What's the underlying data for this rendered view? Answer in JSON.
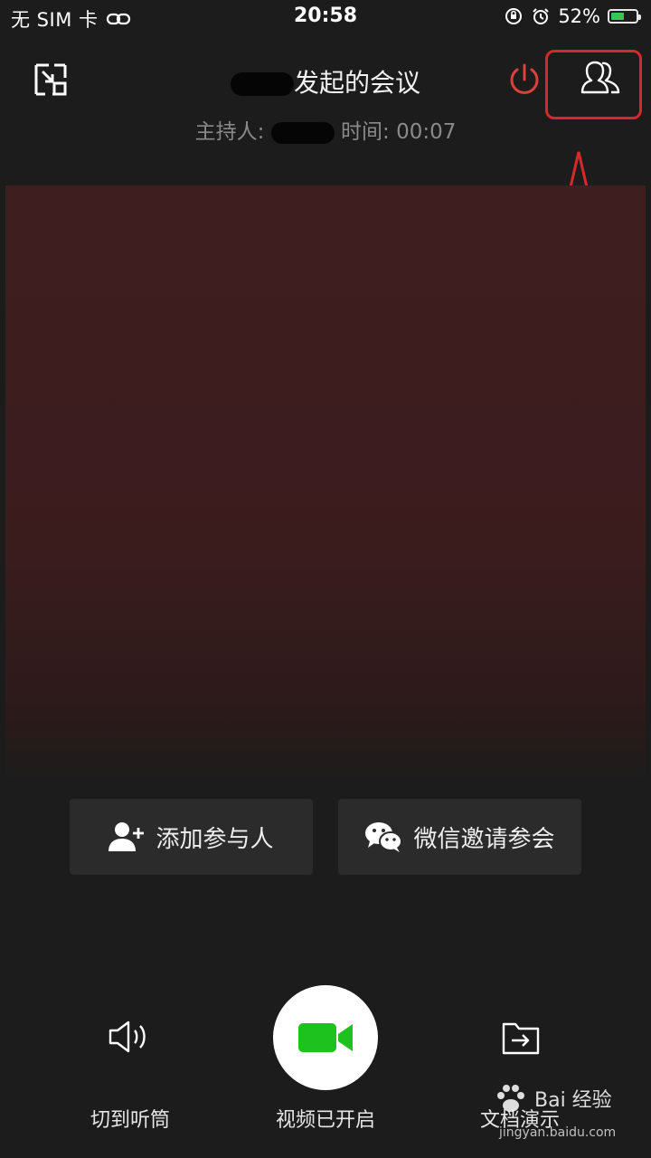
{
  "status_bar": {
    "carrier": "无 SIM 卡",
    "time": "20:58",
    "battery_percent_text": "52%",
    "battery_level": 0.52,
    "icons": [
      "link-icon",
      "orientation-lock-icon",
      "alarm-icon",
      "battery-charging-icon"
    ]
  },
  "header": {
    "title": "发起的会议",
    "host_label": "主持人:",
    "time_label": "时间: 00:07"
  },
  "actions": {
    "add_participant": "添加参与人",
    "wechat_invite": "微信邀请参会"
  },
  "bottom_bar": {
    "earpiece_label": "切到听筒",
    "video_label": "视频已开启",
    "share_label": "文档演示"
  },
  "watermark": {
    "text": "Bai 经验",
    "sub": "jingyan.baidu.com"
  },
  "colors": {
    "background": "#1c1c1c",
    "accent_green": "#1ec21e",
    "end_red": "#d9413a",
    "annotation_red": "#d42a2a",
    "video_tint": "#3f1e1f"
  }
}
